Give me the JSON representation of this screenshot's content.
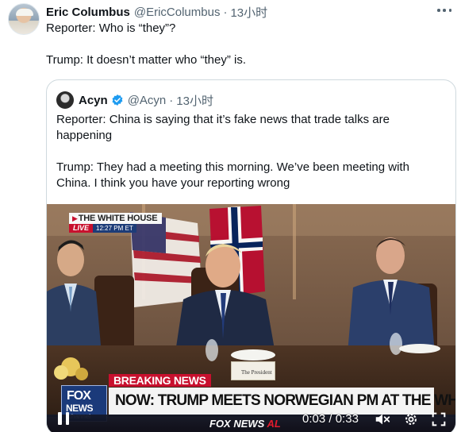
{
  "tweet": {
    "author": {
      "name": "Eric Columbus",
      "handle": "@EricColumbus",
      "separator": "·",
      "time": "13小时"
    },
    "lines": [
      "Reporter: Who is “they”?",
      "Trump: It doesn’t matter who “they” is."
    ],
    "more_icon": "more-dots-icon"
  },
  "quote": {
    "author": {
      "name": "Acyn",
      "handle": "@Acyn",
      "separator": "·",
      "time": "13小时",
      "verified_icon": "verified-badge-icon",
      "verified_color": "#1d9bf0"
    },
    "lines": [
      "Reporter: China is saying that it’s fake news that trade talks are",
      "happening",
      "Trump: They had a meeting this morning. We’ve been meeting with",
      "China. I think you have your reporting wrong"
    ],
    "video": {
      "overlay": {
        "location_title": "THE WHITE HOUSE",
        "live_label": "LIVE",
        "live_time": "12:27 PM ET",
        "breaking_label": "BREAKING NEWS",
        "headline": "NOW: TRUMP MEETS NORWEGIAN PM AT THE WHITE HOUSE",
        "ticker_brand": "FOX NEWS",
        "ticker_suffix": "AL",
        "logo_top": "FOX",
        "logo_middle": "NEWS",
        "logo_bottom": "channel",
        "placard": "The President"
      },
      "controls": {
        "state": "paused",
        "current_time": "0:03",
        "duration": "0:33",
        "time_separator": "/",
        "mute_icon": "speaker-muted-icon",
        "settings_icon": "gear-icon",
        "fullscreen_icon": "fullscreen-icon",
        "pause_icon": "pause-icon"
      }
    }
  },
  "colors": {
    "text_primary": "#0f1419",
    "text_secondary": "#536471",
    "border": "#cfd9de",
    "fox_red": "#c8102e",
    "fox_blue": "#1b3a7a"
  }
}
